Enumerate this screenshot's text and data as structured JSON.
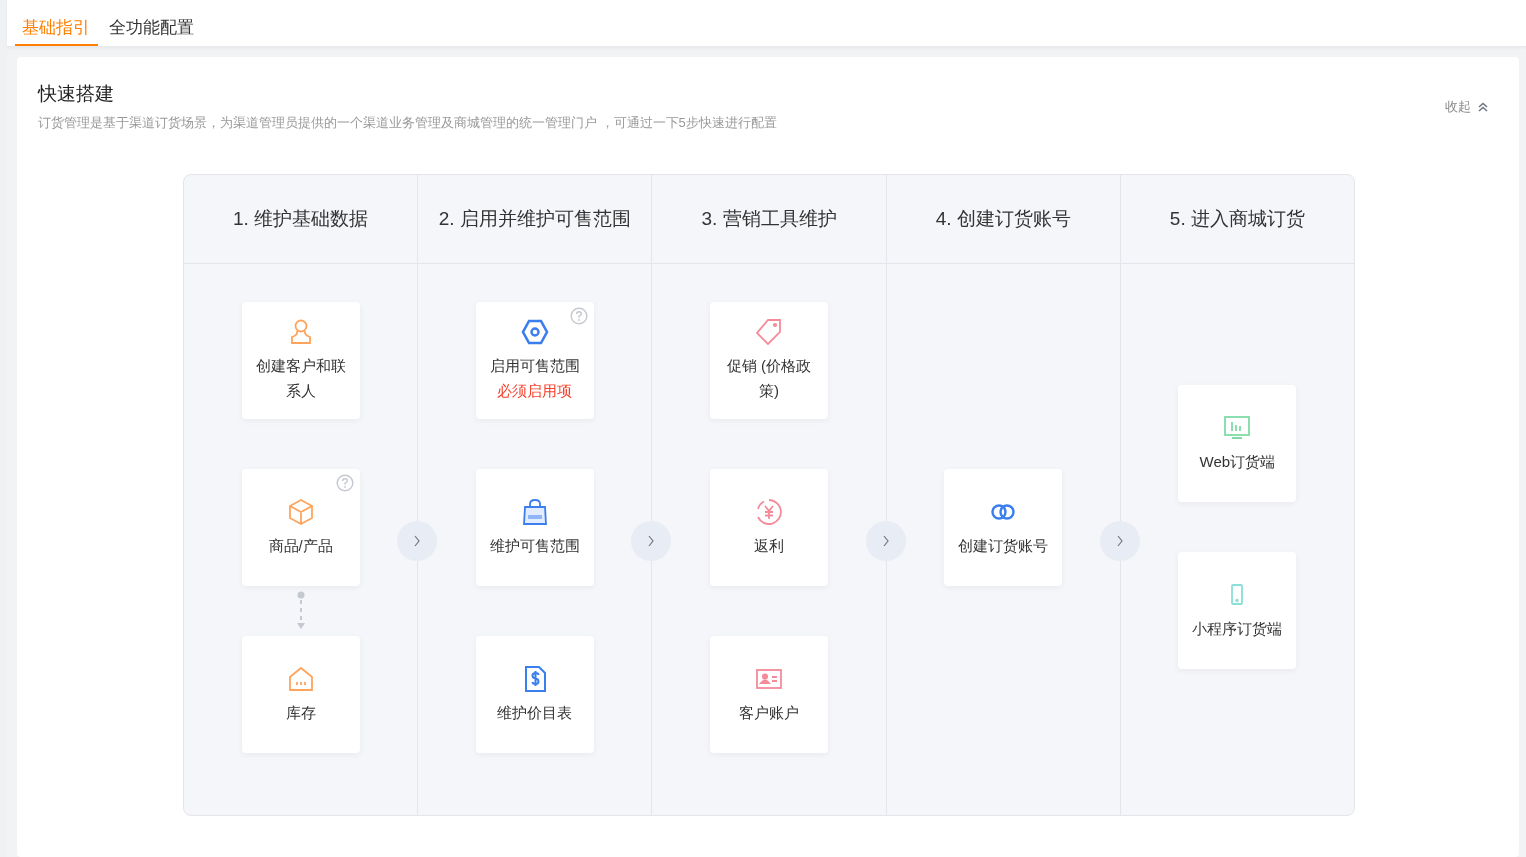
{
  "tabs": [
    {
      "label": "基础指引",
      "selected": true
    },
    {
      "label": "全功能配置",
      "selected": false
    }
  ],
  "section": {
    "title": "快速搭建",
    "description": "订货管理是基于渠道订货场景，为渠道管理员提供的一个渠道业务管理及商城管理的统一管理门户 ，可通过一下5步快速进行配置",
    "collapse": "收起"
  },
  "steps": [
    {
      "title": "1. 维护基础数据",
      "items": [
        {
          "label": "创建客户和联系人",
          "kind": "person",
          "color": "#ffa45c",
          "help": false,
          "linked": false
        },
        {
          "label": "商品/产品",
          "kind": "box",
          "color": "#ffa45c",
          "help": true,
          "linked": true
        },
        {
          "label": "库存",
          "kind": "house",
          "color": "#ffa45c",
          "help": false
        }
      ]
    },
    {
      "title": "2. 启用并维护可售范围",
      "items": [
        {
          "label": "启用可售范围",
          "note": "必须启用项",
          "kind": "hexagon",
          "color": "#3a7ef0",
          "help": true,
          "linked": false
        },
        {
          "label": "维护可售范围",
          "kind": "bag",
          "color": "#3a7ef0",
          "help": false,
          "linked": false
        },
        {
          "label": "维护价目表",
          "kind": "dollar-doc",
          "color": "#3a7ef0",
          "help": false
        }
      ]
    },
    {
      "title": "3. 营销工具维护",
      "items": [
        {
          "label": "促销 (价格政策)",
          "kind": "tag",
          "color": "#f58a99",
          "help": false,
          "linked": false
        },
        {
          "label": "返利",
          "kind": "yen",
          "color": "#f58a99",
          "help": false,
          "linked": false
        },
        {
          "label": "客户账户",
          "kind": "idcard",
          "color": "#f58a99",
          "help": false
        }
      ]
    },
    {
      "title": "4. 创建订货账号",
      "items": [
        {
          "label": "创建订货账号",
          "kind": "rings",
          "color": "#3a7ef0",
          "help": false
        }
      ]
    },
    {
      "title": "5. 进入商城订货",
      "items": [
        {
          "label": "Web订货端",
          "kind": "monitor",
          "color": "#7fdba6",
          "help": false,
          "linked": false
        },
        {
          "label": "小程序订货端",
          "kind": "phone",
          "color": "#8adfd6",
          "help": false
        }
      ]
    }
  ]
}
